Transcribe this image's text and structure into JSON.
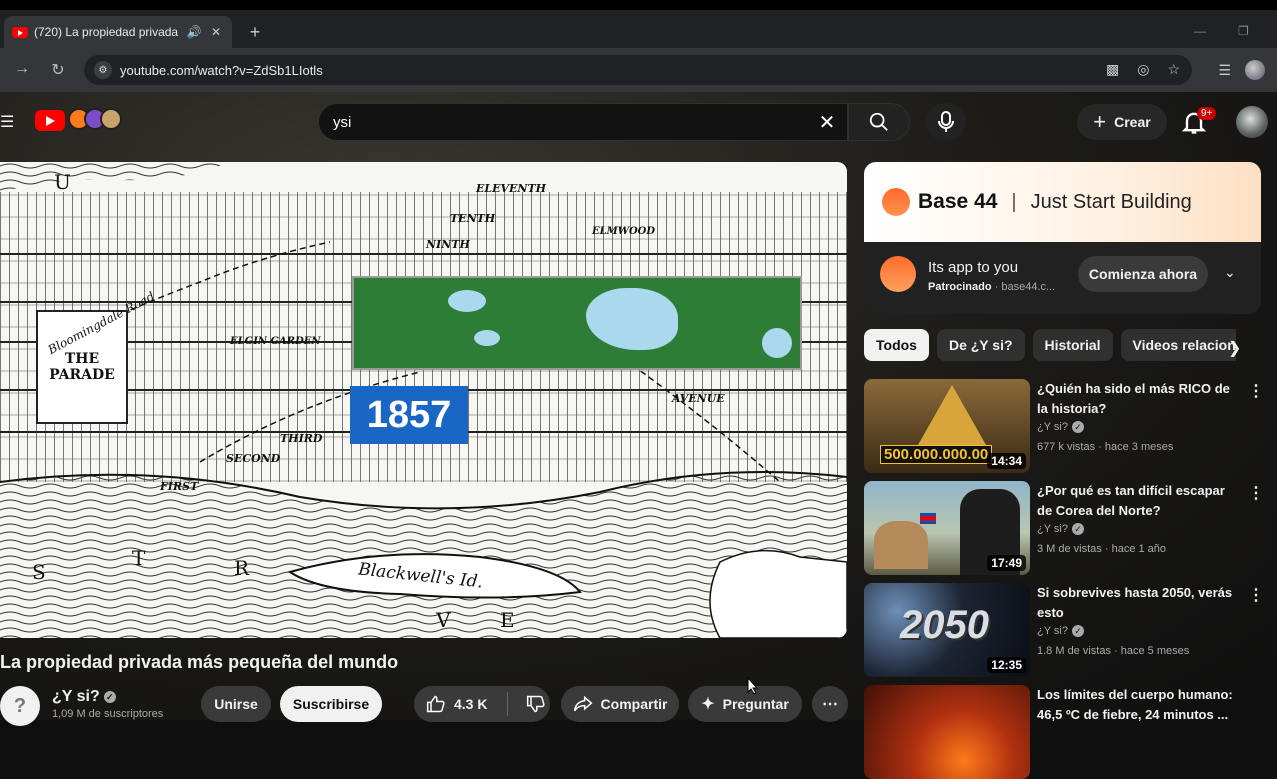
{
  "browser": {
    "tab_title": "(720) La propiedad privada",
    "url": "youtube.com/watch?v=ZdSb1LIotls"
  },
  "youtube": {
    "search_query": "ysi",
    "create_label": "Crear",
    "notification_count": "9+"
  },
  "video": {
    "map_year": "1857",
    "map_labels": {
      "parade_line1": "THE",
      "parade_line2": "PARADE",
      "island": "Blackwell's Id.",
      "river_s": "S",
      "river_t": "T",
      "river_r": "R",
      "river_v": "V",
      "river_e": "E",
      "u": "U",
      "eleventh": "ELEVENTH",
      "tenth": "TENTH",
      "ninth": "NINTH",
      "second": "SECOND",
      "third": "THIRD",
      "first": "FIRST",
      "avenue": "AVENUE",
      "elgin": "ELGIN GARDEN",
      "elmwood": "ELMWOOD",
      "bloomingdale": "Bloomingdale Road"
    },
    "title": "La propiedad privada más pequeña del mundo",
    "channel_name": "¿Y si?",
    "subscribers": "1,09 M de suscriptores",
    "join_label": "Unirse",
    "subscribe_label": "Suscribirse",
    "likes": "4.3 K",
    "share_label": "Compartir",
    "ask_label": "Preguntar"
  },
  "ad": {
    "brand": "Base 44",
    "tagline": "Just Start Building",
    "headline": "Its app to you",
    "sponsored": "Patrocinado",
    "domain": "· base44.c...",
    "cta": "Comienza ahora"
  },
  "chips": [
    "Todos",
    "De ¿Y si?",
    "Historial",
    "Videos relacionados"
  ],
  "recommendations": [
    {
      "title_line1": "¿Quién ha sido el más RICO de",
      "title_line2": "la historia?",
      "channel": "¿Y si?",
      "meta": "677 k vistas · hace 3 meses",
      "duration": "14:34",
      "thumb_text": "500.000.000.00"
    },
    {
      "title_line1": "¿Por qué es tan difícil escapar",
      "title_line2": "de Corea del Norte?",
      "channel": "¿Y si?",
      "meta": "3 M de vistas · hace 1 año",
      "duration": "17:49",
      "thumb_text": ""
    },
    {
      "title_line1": "Si sobrevives hasta 2050, verás",
      "title_line2": "esto",
      "channel": "¿Y si?",
      "meta": "1.8 M de vistas · hace 5 meses",
      "duration": "12:35",
      "thumb_text": "2050"
    },
    {
      "title_line1": "Los límites del cuerpo humano:",
      "title_line2": "46,5 ºC de fiebre, 24 minutos ...",
      "channel": "",
      "meta": "",
      "duration": "",
      "thumb_text": ""
    }
  ],
  "colors": {
    "youtube_red": "#ff0000",
    "year_box_blue": "#1966c4",
    "park_green": "#2e7d36",
    "ad_orange": "#ff6b2c"
  }
}
